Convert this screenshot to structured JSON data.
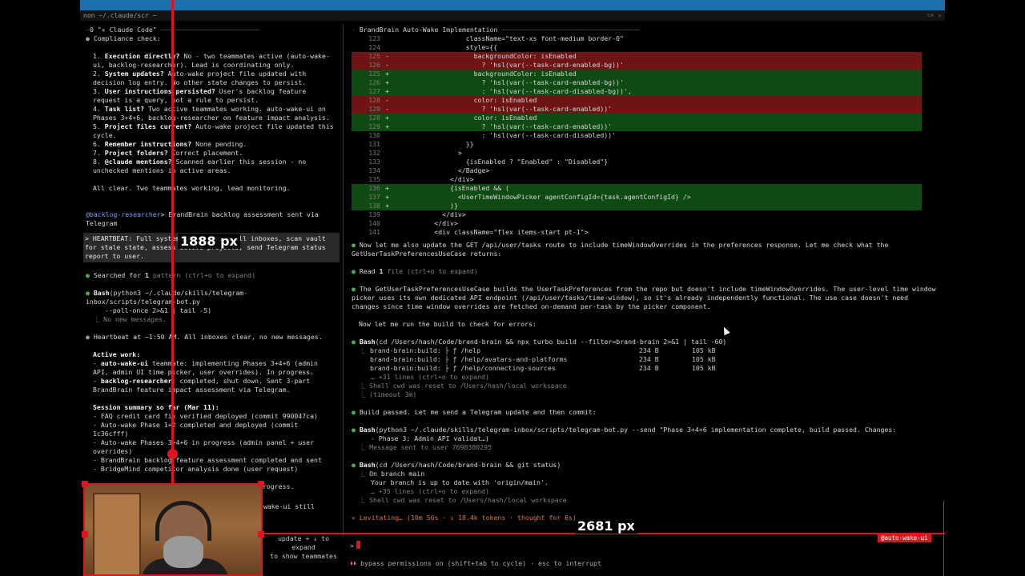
{
  "title_tab": "non ~/.claude/scr ~",
  "left": {
    "header": "0 \"✳ Claude Code\"",
    "compliance_heading": "Compliance check:",
    "checklist": [
      {
        "n": "1.",
        "bold": "Execution directly?",
        "text": " No - two teammates active (auto-wake-ui, backlog-researcher). Lead is coordinating only."
      },
      {
        "n": "2.",
        "bold": "System updates?",
        "text": " Auto-wake project file updated with decision log entry. No other state changes to persist."
      },
      {
        "n": "3.",
        "bold": "User instructions persisted?",
        "text": " User's backlog feature request is a query, not a rule to persist."
      },
      {
        "n": "4.",
        "bold": "Task list?",
        "text": " Two active teammates working. auto-wake-ui on Phases 3+4+6, backlog-researcher on feature impact analysis."
      },
      {
        "n": "5.",
        "bold": "Project files current?",
        "text": " Auto-wake project file updated this cycle."
      },
      {
        "n": "6.",
        "bold": "Remember instructions?",
        "text": " None pending."
      },
      {
        "n": "7.",
        "bold": "Project folders?",
        "text": " Correct placement."
      },
      {
        "n": "8.",
        "bold": "@claude mentions?",
        "text": " Scanned earlier this session - no unchecked mentions in active areas."
      }
    ],
    "all_clear": "All clear. Two teammates working, lead monitoring.",
    "mention_name": "@backlog-researcher",
    "mention_text": "> BrandBrain backlog assessment sent via Telegram",
    "heartbeat_prompt": "> HEARTBEAT: Full system check. Check all inboxes, scan vault for stale state, assess active projects, send Telegram status report to user.",
    "searched_pre": "Searched for ",
    "searched_count": "1",
    "searched_post": " pattern (ctrl+o to expand)",
    "bash_label": "Bash",
    "bash_cmd_1": "(python3 ~/.claude/skills/telegram-inbox/scripts/telegram-bot.py",
    "bash_cmd_2": "--poll-once 2>&1 | tail -5)",
    "bash_result": "No new messages.",
    "heartbeat_line": "Heartbeat at ~1:50 AM. All inboxes clear, no new messages.",
    "active_work_heading": "Active work:",
    "active_items": [
      {
        "name": "auto-wake-ui",
        "text": " teammate: implementing Phases 3+4+6 (admin API, admin UI time picker, user overrides). In progress."
      },
      {
        "name": "backlog-researcher",
        "text": ": completed, shut down. Sent 3-part BrandBrain feature impact assessment via Telegram."
      }
    ],
    "summary_heading": "Session summary so far (Mar 11):",
    "summary_items": [
      "- FAQ credit card fix verified deployed (commit 990047ca)",
      "- Auto-wake Phase 1+2 completed and deployed (commit 1c36cfff)",
      "- Auto-wake Phases 3+4+6 in progress (admin panel + user overrides)",
      "- BrandBrain backlog feature assessment completed and sent",
      "- BridgeMind competitor analysis done (user request)"
    ],
    "continues": "Session continues monitoring auto-wake-ui progress.",
    "final_line": "backlog-researcher shut down cleanly. auto-wake-ui still working on Phases 3+4+6.",
    "overlay_text": "update + ↓ to expand\nto show teammates"
  },
  "right": {
    "header": "BrandBrain Auto-Wake Implementation",
    "diff": [
      {
        "ln": "123",
        "sign": "",
        "kind": "ctx",
        "code": "                  className=\"text-xs font-medium border-0\""
      },
      {
        "ln": "124",
        "sign": "",
        "kind": "ctx",
        "code": "                  style={{"
      },
      {
        "ln": "125",
        "sign": "-",
        "kind": "del",
        "code": "                    backgroundColor: isEnabled"
      },
      {
        "ln": "126",
        "sign": "-",
        "kind": "del",
        "code": "                      ? 'hsl(var(--task-card-enabled-bg))'"
      },
      {
        "ln": "125",
        "sign": "+",
        "kind": "add",
        "code": "                    backgroundColor: isEnabled"
      },
      {
        "ln": "126",
        "sign": "+",
        "kind": "add",
        "code": "                      ? 'hsl(var(--task-card-enabled-bg))'"
      },
      {
        "ln": "127",
        "sign": "+",
        "kind": "add",
        "code": "                      : 'hsl(var(--task-card-disabled-bg))',"
      },
      {
        "ln": "128",
        "sign": "-",
        "kind": "del",
        "code": "                    color: isEnabled"
      },
      {
        "ln": "129",
        "sign": "-",
        "kind": "del",
        "code": "                      ? 'hsl(var(--task-card-enabled))'"
      },
      {
        "ln": "128",
        "sign": "+",
        "kind": "add",
        "code": "                    color: isEnabled"
      },
      {
        "ln": "129",
        "sign": "+",
        "kind": "add",
        "code": "                      ? 'hsl(var(--task-card-enabled))'"
      },
      {
        "ln": "130",
        "sign": "",
        "kind": "ctx",
        "code": "                      : 'hsl(var(--task-card-disabled))'"
      },
      {
        "ln": "131",
        "sign": "",
        "kind": "ctx",
        "code": "                  }}"
      },
      {
        "ln": "132",
        "sign": "",
        "kind": "ctx",
        "code": "                >"
      },
      {
        "ln": "133",
        "sign": "",
        "kind": "ctx",
        "code": "                  {isEnabled ? \"Enabled\" : \"Disabled\"}"
      },
      {
        "ln": "134",
        "sign": "",
        "kind": "ctx",
        "code": "                </Badge>"
      },
      {
        "ln": "135",
        "sign": "",
        "kind": "ctx",
        "code": "              </div>"
      },
      {
        "ln": "136",
        "sign": "+",
        "kind": "add",
        "code": "              {isEnabled && ("
      },
      {
        "ln": "137",
        "sign": "+",
        "kind": "add",
        "code": "                <UserTimeWindowPicker agentConfigId={task.agentConfigId} />"
      },
      {
        "ln": "138",
        "sign": "+",
        "kind": "add",
        "code": "              )}"
      },
      {
        "ln": "139",
        "sign": "",
        "kind": "ctx",
        "code": "            </div>"
      },
      {
        "ln": "140",
        "sign": "",
        "kind": "ctx",
        "code": "          </div>"
      },
      {
        "ln": "141",
        "sign": "",
        "kind": "ctx",
        "code": "          <div className=\"flex items-start pt-1\">"
      }
    ],
    "msg1": "Now let me also update the GET /api/user/tasks route to include timeWindowOverrides in the preferences response. Let me check what the GetUserTaskPreferencesUseCase returns:",
    "read_label": "Read",
    "read_count": "1",
    "read_rest": " file (ctrl+o to expand)",
    "msg2": "The GetUserTaskPreferencesUseCase builds the UserTaskPreferences from the repo but doesn't include timeWindowOverrides. The user-level time window picker uses its own dedicated API endpoint (/api/user/tasks/time-window), so it's already independently functional. The use case doesn't need changes since time window overrides are fetched on-demand per-task by the picker component.",
    "msg3": "Now let me run the build to check for errors:",
    "bash1_label": "Bash",
    "bash1_cmd": "(cd /Users/hash/Code/brand-brain && npx turbo build --filter=brand-brain 2>&1 | tail -60)",
    "build_rows": [
      {
        "left": "brand-brain:build: ├ ƒ /help",
        "size": "234 B",
        "js": "105 kB"
      },
      {
        "left": "brand-brain:build: ├ ƒ /help/avatars-and-platforms",
        "size": "234 B",
        "js": "105 kB"
      },
      {
        "left": "brand-brain:build: ├ ƒ /help/connecting-sources",
        "size": "234 B",
        "js": "105 kB"
      }
    ],
    "build_more": "… +31 lines (ctrl+o to expand)",
    "build_cwd": "Shell cwd was reset to /Users/hash/local workspace",
    "build_timeout": "(timeout 3m)",
    "msg4": "Build passed. Let me send a Telegram update and then commit:",
    "bash2_label": "Bash",
    "bash2_cmd": "(python3 ~/.claude/skills/telegram-inbox/scripts/telegram-bot.py --send \"Phase 3+4+6 implementation complete, build passed. Changes:",
    "bash2_cmd2": "- Phase 3: Admin API validat…)",
    "bash2_result": "Message sent to user 7698380295",
    "bash3_label": "Bash",
    "bash3_cmd": "(cd /Users/hash/Code/brand-brain && git status)",
    "git_lines": [
      "On branch main",
      "Your branch is up to date with 'origin/main'.",
      "… +35 lines (ctrl+o to expand)",
      "Shell cwd was reset to /Users/hash/local workspace"
    ],
    "levitating": "✳ Levitating… (10m 56s · ↓ 18.4k tokens · thought for 6s)",
    "prompt_caret": ">",
    "mode_badge": "@auto-wake-ui",
    "status_arrows": "⏵⏵",
    "status_text": " bypass permissions on (shift+tab to cycle) · esc to interrupt"
  },
  "measurements": {
    "vertical": "1888 px",
    "horizontal": "2681 px"
  },
  "colors": {
    "titlebar": "#1d6fae",
    "accent_red": "#e0141f",
    "diff_del": "#6e1414",
    "diff_add": "#0e4a12",
    "success_green": "#4caf50",
    "claude_orange": "#d97757"
  }
}
